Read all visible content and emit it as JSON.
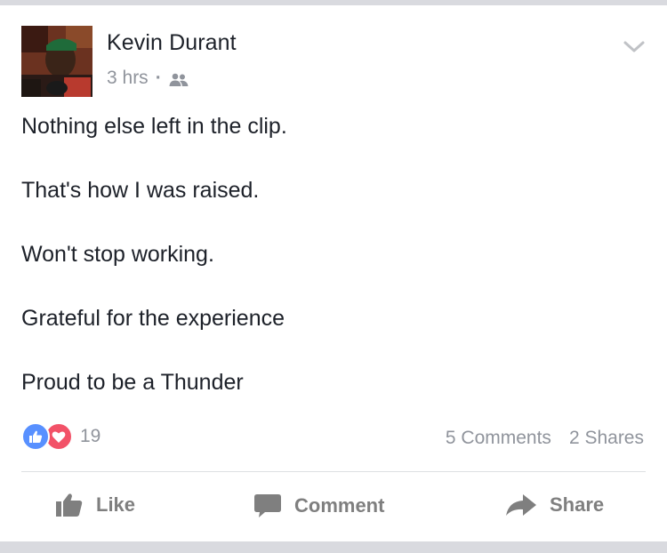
{
  "post": {
    "author": "Kevin Durant",
    "time": "3 hrs",
    "separator": "·",
    "audience_icon": "friends-icon",
    "lines": [
      "Nothing else left in the clip.",
      "That's how I was raised.",
      "Won't stop working.",
      "Grateful for the experience",
      "Proud to be a Thunder"
    ]
  },
  "engagement": {
    "reaction_count": "19",
    "comments": "5 Comments",
    "shares": "2 Shares",
    "like_color": "#5890ff",
    "love_color": "#f25268"
  },
  "actions": {
    "like": "Like",
    "comment": "Comment",
    "share": "Share"
  }
}
